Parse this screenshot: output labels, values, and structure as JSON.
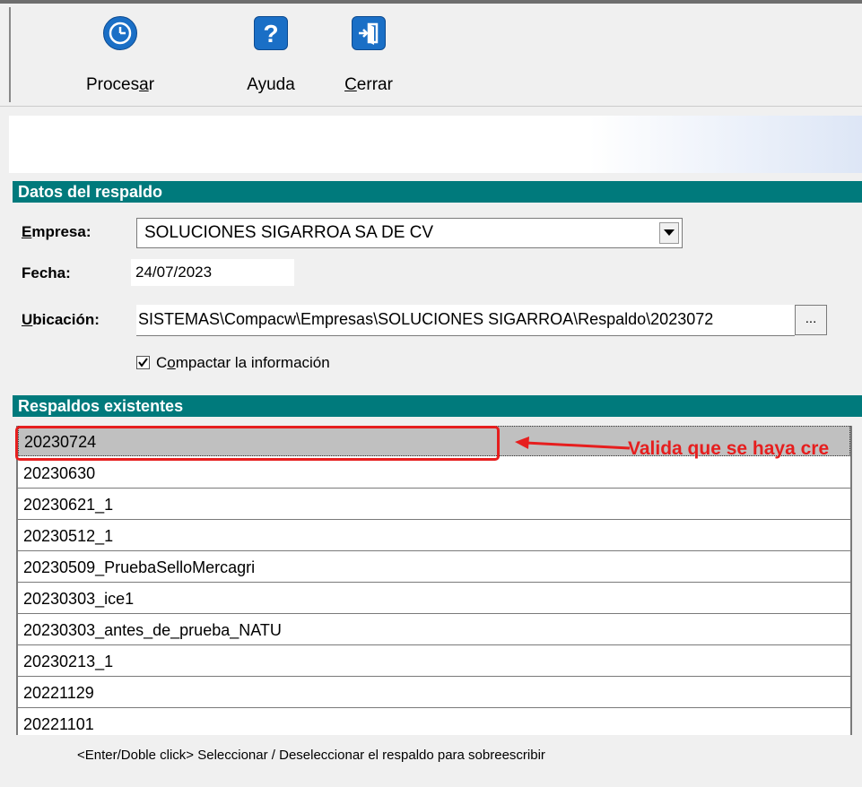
{
  "toolbar": {
    "procesar": {
      "label_pre": "Proces",
      "label_u": "a",
      "label_post": "r",
      "icon": "clock-icon"
    },
    "ayuda": {
      "label": "Ayuda",
      "icon": "help-icon"
    },
    "cerrar": {
      "label_u": "C",
      "label_post": "errar",
      "icon": "exit-door-icon"
    }
  },
  "datos": {
    "header": "Datos del respaldo",
    "empresa_label_u": "E",
    "empresa_label_post": "mpresa:",
    "empresa_value": "SOLUCIONES SIGARROA SA DE CV",
    "fecha_label": "Fecha:",
    "fecha_value": "24/07/2023",
    "ubicacion_label_u": "U",
    "ubicacion_label_post": "bicación:",
    "ubicacion_value": "SISTEMAS\\Compacw\\Empresas\\SOLUCIONES SIGARROA\\Respaldo\\2023072",
    "browse_label": "...",
    "compactar_checked": true,
    "compactar_label_pre": "C",
    "compactar_label_u": "o",
    "compactar_label_post": "mpactar la información"
  },
  "respaldos": {
    "header": "Respaldos existentes",
    "items": [
      "20230724",
      "20230630",
      "20230621_1",
      "20230512_1",
      "20230509_PruebaSelloMercagri",
      "20230303_ice1",
      "20230303_antes_de_prueba_NATU",
      "20230213_1",
      "20221129",
      "20221101"
    ],
    "selected_index": 0
  },
  "annotation": {
    "text": "Valida que se haya cre",
    "color": "#e61e1e"
  },
  "hint": "<Enter/Doble click> Seleccionar / Deseleccionar el respaldo para sobreescribir",
  "colors": {
    "section_header": "#007a7c",
    "icon_blue": "#1a6fc6",
    "selected_row": "#c0c0c0"
  }
}
